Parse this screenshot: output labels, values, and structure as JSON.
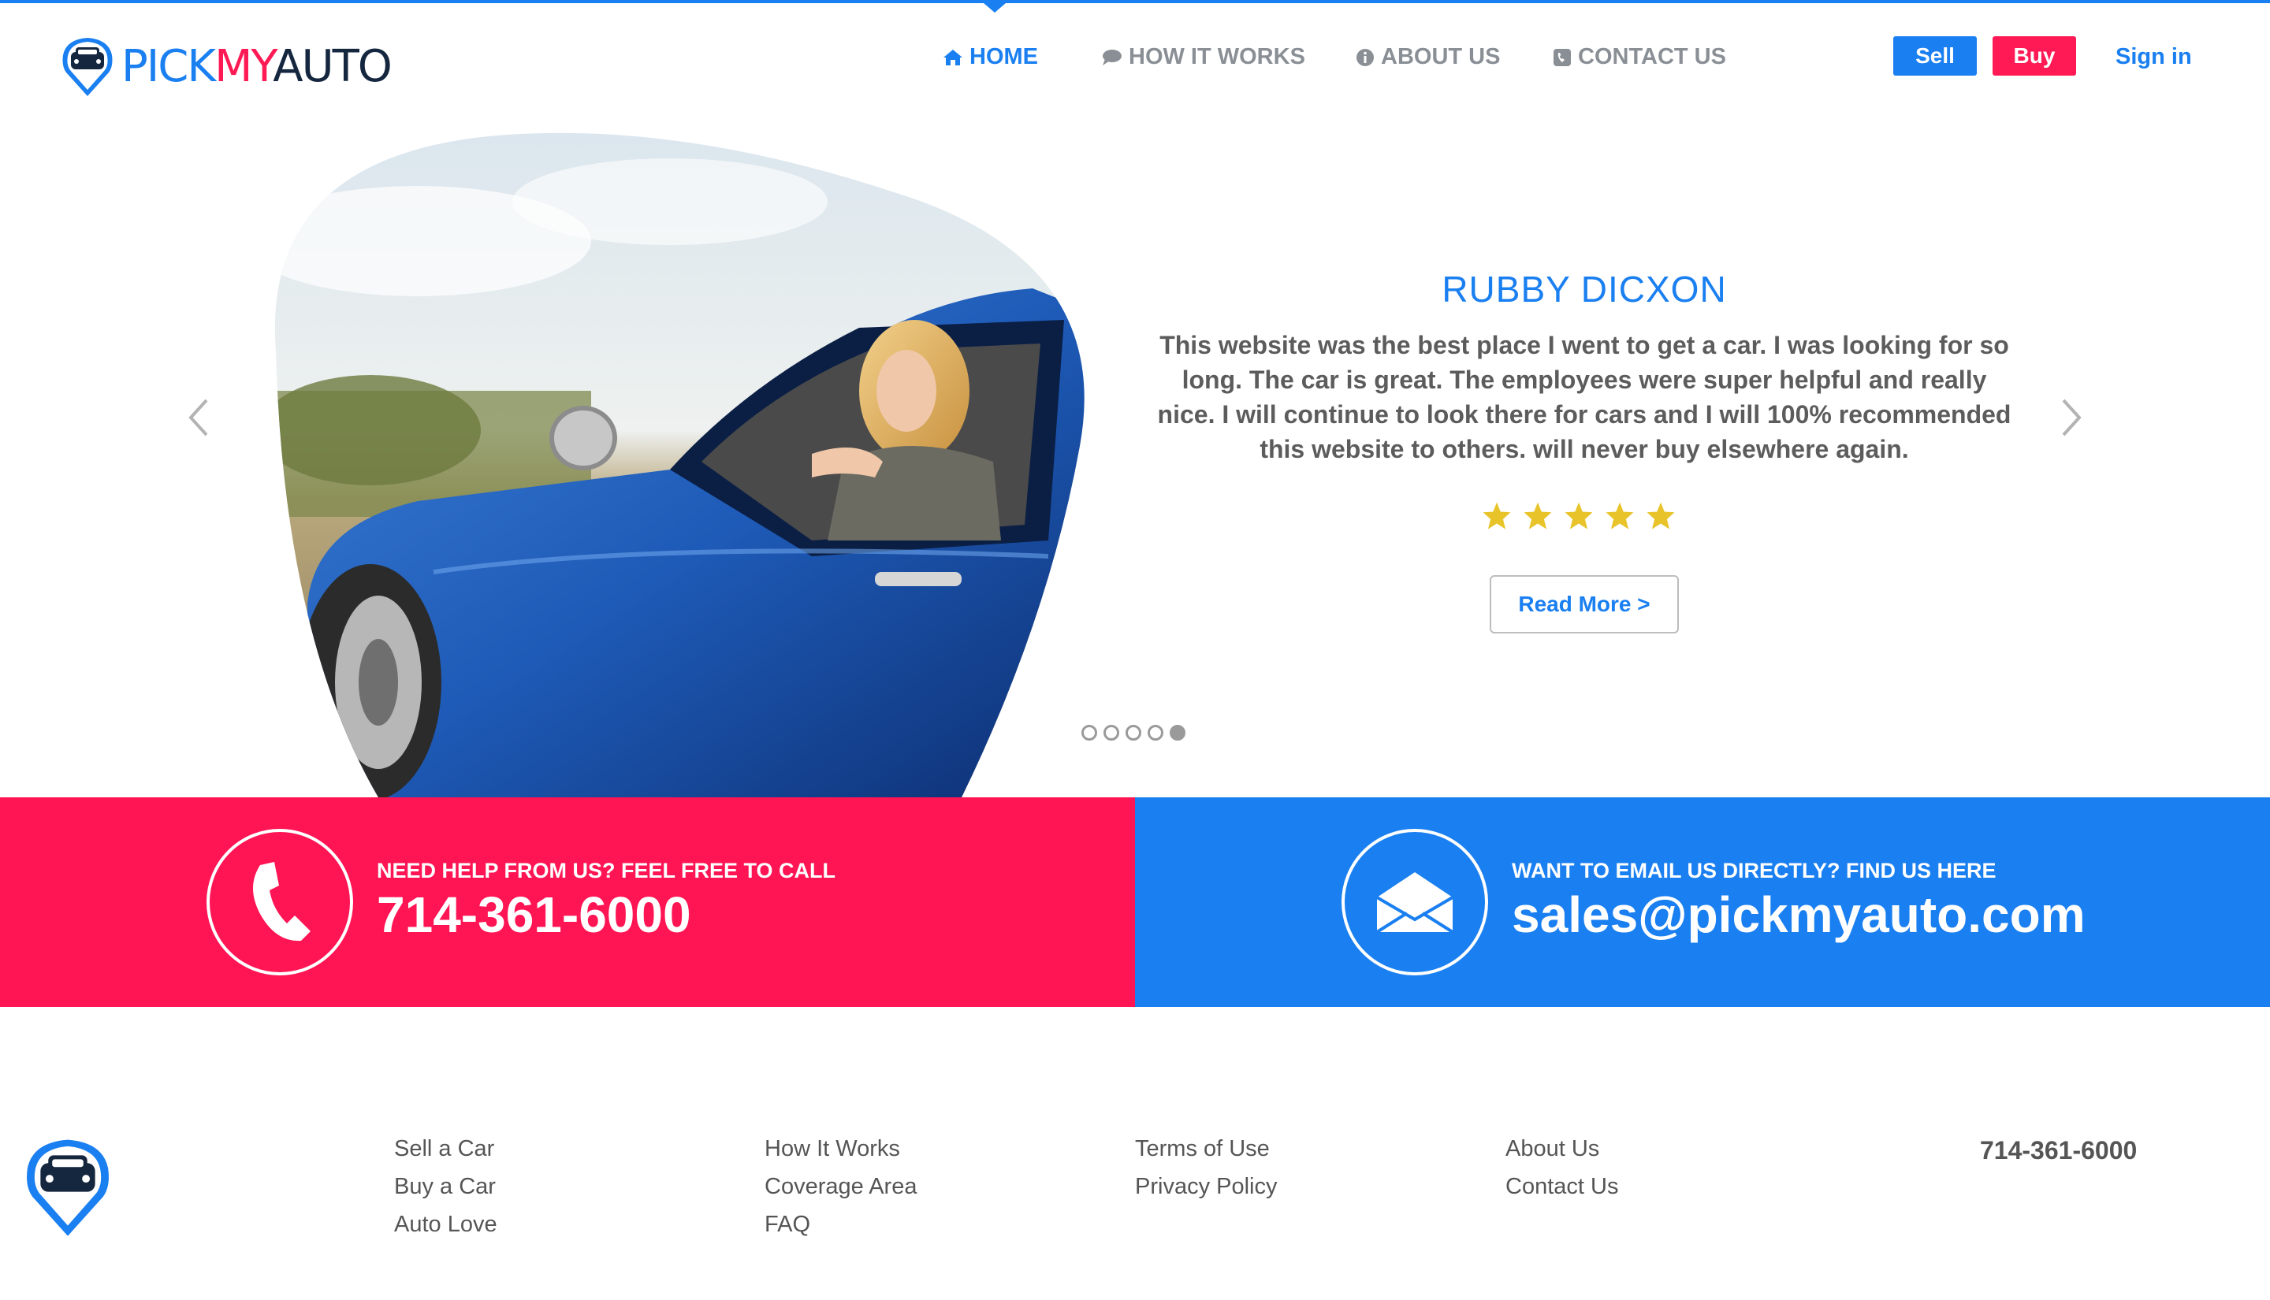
{
  "brand": {
    "logo_part1": "PICK",
    "logo_part2": "MY",
    "logo_part3": "AUTO",
    "colors": {
      "primary": "#1a7ff0",
      "accent": "#ff1454",
      "dark": "#15263f"
    }
  },
  "nav": {
    "items": [
      {
        "label": "HOME",
        "icon": "home-icon",
        "active": true
      },
      {
        "label": "HOW IT WORKS",
        "icon": "chat-icon",
        "active": false
      },
      {
        "label": "ABOUT US",
        "icon": "info-icon",
        "active": false
      },
      {
        "label": "CONTACT US",
        "icon": "phone-square-icon",
        "active": false
      }
    ],
    "sell_label": "Sell",
    "buy_label": "Buy",
    "signin_label": "Sign in"
  },
  "testimonial": {
    "name": "RUBBY DICXON",
    "quote": "This website was the best place I went to get a car. I was looking for so long. The car is great. The employees were super helpful and really nice. I will continue to look there for cars and I will 100% recommended this website to others. will never buy elsewhere again.",
    "rating": 5,
    "read_more_label": "Read More >",
    "slide_count": 5,
    "active_slide": 5
  },
  "contact": {
    "phone_label": "NEED HELP FROM US? FEEL FREE TO CALL",
    "phone": "714-361-6000",
    "email_label": "WANT TO EMAIL US DIRECTLY? FIND US HERE",
    "email": "sales@pickmyauto.com"
  },
  "footer": {
    "col1": [
      "Sell a Car",
      "Buy a Car",
      "Auto Love"
    ],
    "col2": [
      "How It Works",
      "Coverage Area",
      "FAQ"
    ],
    "col3": [
      "Terms of Use",
      "Privacy Policy"
    ],
    "col4": [
      "About Us",
      "Contact Us"
    ],
    "phone": "714-361-6000"
  }
}
